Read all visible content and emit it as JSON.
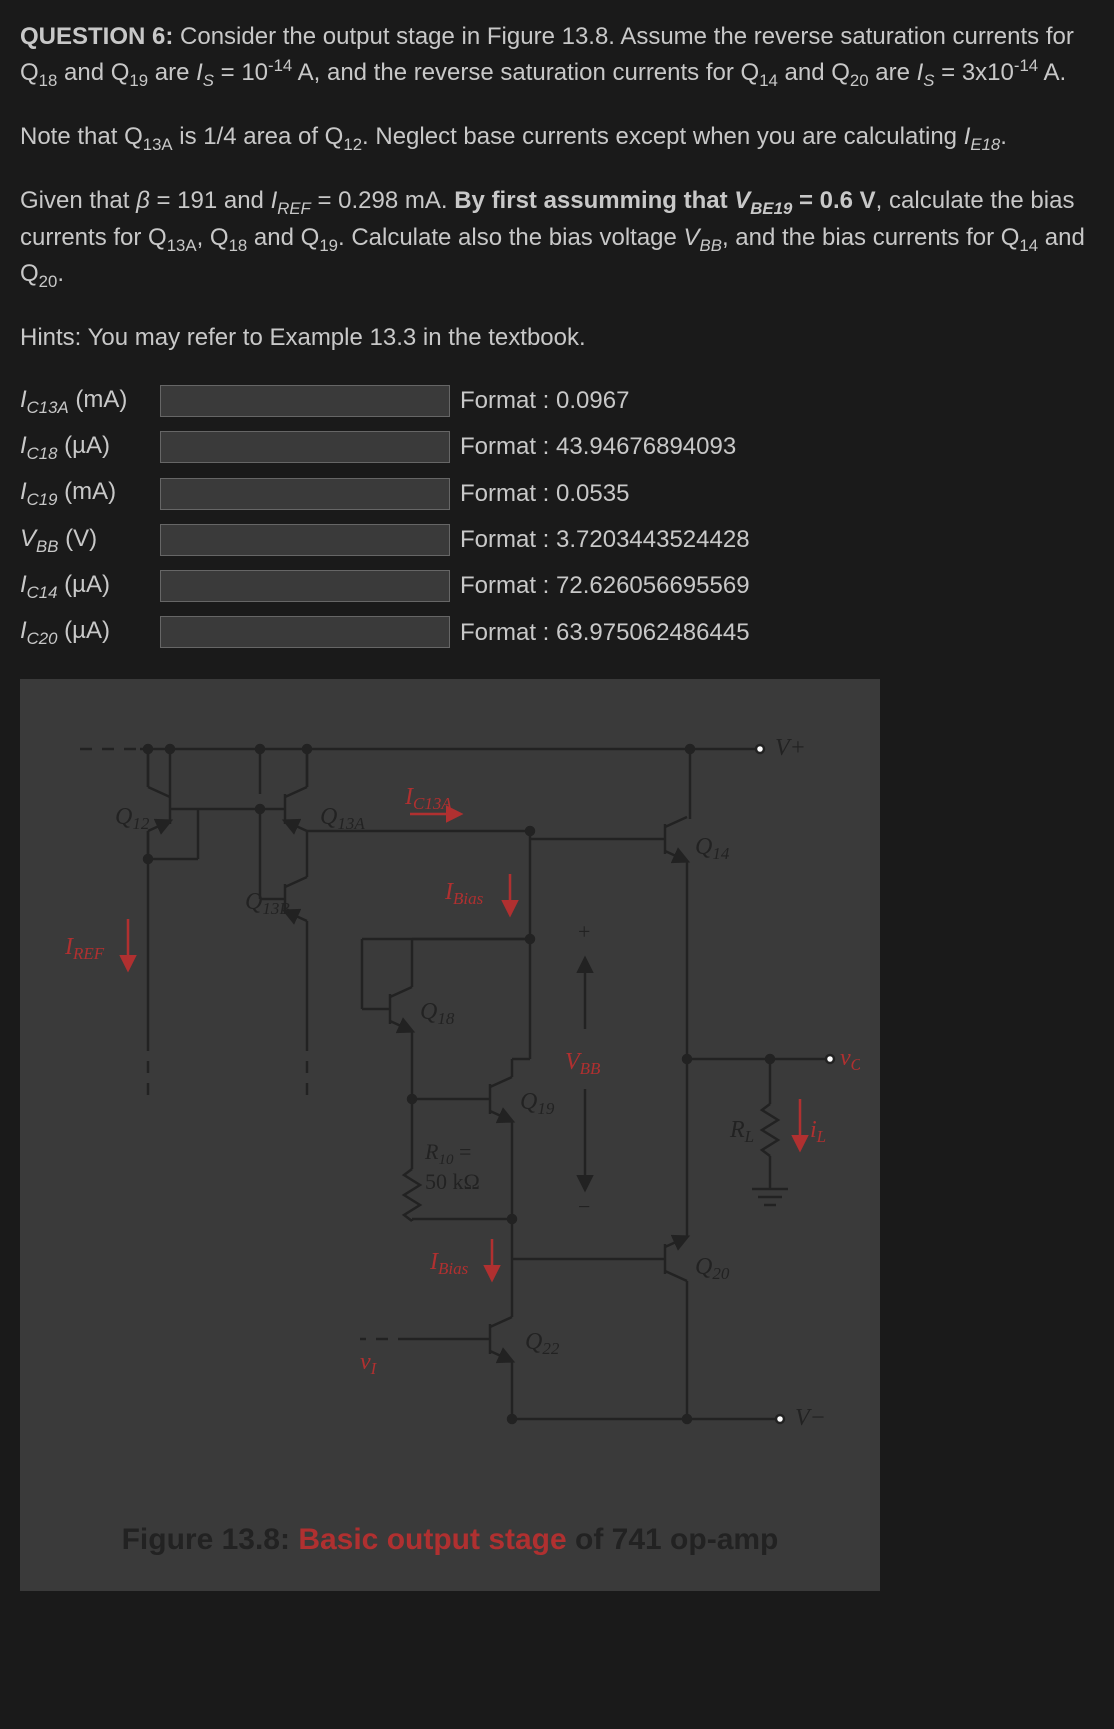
{
  "question": {
    "prefix": "QUESTION 6:",
    "p1_a": " Consider the output stage in Figure 13.8. Assume the reverse saturation currents for Q",
    "p1_sub1": "18",
    "p1_b": " and Q",
    "p1_sub2": "19",
    "p1_c": " are ",
    "p1_is": "I",
    "p1_s": "S",
    "p1_d": " = 10",
    "p1_sup1": "-14",
    "p1_e": " A, and the reverse saturation currents for Q",
    "p1_sub3": "14",
    "p1_f": " and Q",
    "p1_sub4": "20",
    "p1_g": " are ",
    "p1_h": " = 3x10",
    "p1_sup2": "-14",
    "p1_i": " A.",
    "p2_a": "Note that Q",
    "p2_sub1": "13A",
    "p2_b": " is 1/4 area of Q",
    "p2_sub2": "12",
    "p2_c": ". Neglect base currents except when you are calculating ",
    "p2_ie": "I",
    "p2_esub": "E18",
    "p2_d": ".",
    "p3_a": "Given that ",
    "p3_beta": "β",
    "p3_b": " = 191 and ",
    "p3_iref": "I",
    "p3_refsub": "REF",
    "p3_c": " = 0.298 mA. ",
    "p3_bold": "By first assumming that ",
    "p3_vbe": "V",
    "p3_besub": "BE19",
    "p3_bold2": " = 0.6 V",
    "p3_d": ", calculate the bias currents for Q",
    "p3_sub1": "13A",
    "p3_e": ", Q",
    "p3_sub2": "18",
    "p3_f": " and Q",
    "p3_sub3": "19",
    "p3_g": ". Calculate also the bias voltage ",
    "p3_vbb": "V",
    "p3_bbsub": "BB",
    "p3_h": ", and the bias currents for Q",
    "p3_sub4": "14",
    "p3_i": " and Q",
    "p3_sub5": "20",
    "p3_j": ".",
    "hints": "Hints: You may refer to Example 13.3 in the textbook."
  },
  "inputs": [
    {
      "labelI": "I",
      "labelSub": "C13A",
      "unit": "(mA)",
      "format": "Format : 0.0967"
    },
    {
      "labelI": "I",
      "labelSub": "C18",
      "unit": "(µA)",
      "format": "Format : 43.94676894093"
    },
    {
      "labelI": "I",
      "labelSub": "C19",
      "unit": "(mA)",
      "format": "Format : 0.0535"
    },
    {
      "labelI": "V",
      "labelSub": "BB",
      "unit": "(V)",
      "format": "Format : 3.7203443524428"
    },
    {
      "labelI": "I",
      "labelSub": "C14",
      "unit": "(µA)",
      "format": "Format : 72.626056695569"
    },
    {
      "labelI": "I",
      "labelSub": "C20",
      "unit": "(µA)",
      "format": "Format : 63.975062486445"
    }
  ],
  "figure": {
    "labels": {
      "vplus": "V+",
      "vminus": "V−",
      "q12": "Q12",
      "q13a": "Q13A",
      "q13b": "Q13B",
      "q14": "Q14",
      "q18": "Q18",
      "q19": "Q19",
      "q20": "Q20",
      "q22": "Q22",
      "iref": "IREF",
      "ic13a": "IC13A",
      "ibias1": "IBias",
      "ibias2": "IBias",
      "vbb": "VBB",
      "vo": "vO",
      "vi": "vI",
      "rl": "RL",
      "il": "iL",
      "r10": "R10 =",
      "r10v": "50 kΩ",
      "plus": "+",
      "minus": "−"
    },
    "caption_a": "Figure 13.8: ",
    "caption_b": "Basic output stage",
    "caption_c": " of 741 op-amp"
  }
}
